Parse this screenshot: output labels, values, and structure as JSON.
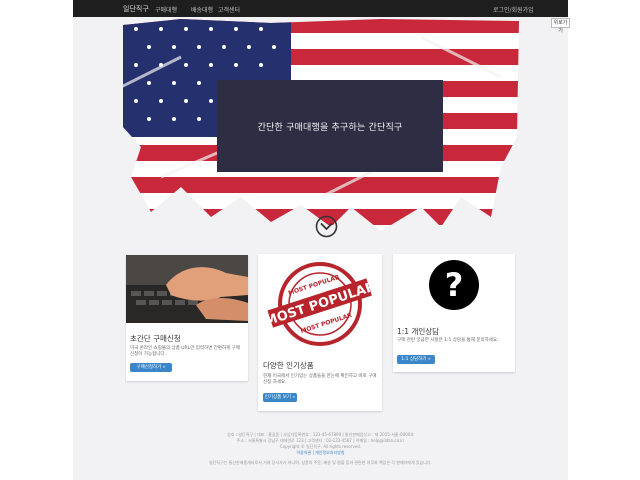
{
  "topbar": {
    "logo": "일단직구",
    "nav": [
      "구매대행",
      "배송대행",
      "고객센터"
    ],
    "right": "로그인/회원가입"
  },
  "side_tag": "위로가기",
  "hero": {
    "headline": "간단한 구매대행을 추구하는 간단직구"
  },
  "cards": [
    {
      "title": "초간단 구매신청",
      "desc": "미국 온라인 쇼핑몰의 상품 URL만 입력하면 간편하게 구매신청이 가능합니다.",
      "button": "구매신청하기 »"
    },
    {
      "title": "다양한 인기상품",
      "desc": "현재 미국에서 인기있는 상품들을 한눈에 확인하고 바로 구매신청 하세요.",
      "button": "인기상품 보기 »"
    },
    {
      "title": "1:1 개인상담",
      "desc": "구매 관련 궁금한 사항은 1:1 상담을 통해 문의하세요.",
      "button": "1:1 상담하기 »"
    }
  ],
  "footer": {
    "line1": "상호 : 일단직구 | 대표 : 홍길동 | 사업자등록번호 : 123-45-67890 | 통신판매업신고 : 제 2015-서울-0000호",
    "line2": "주소 : 서울특별시 강남구 테헤란로 123 | 고객센터 : 02-123-4567 | 이메일 : help@ildan.co.kr",
    "line3": "Copyright © 일단직구. All rights reserved.",
    "line4": "이용약관 | 개인정보처리방침",
    "line5": "일단직구는 통신판매중개자로서 거래 당사자가 아니며, 상품의 주문, 배송 및 환불 등과 관련한 의무와 책임은 각 판매자에게 있습니다."
  },
  "colors": {
    "topbar": "#1e1e1e",
    "hero_box": "#2e2d44",
    "button": "#3a86c8",
    "flag_red": "#c8283a",
    "flag_blue": "#25306e"
  },
  "icons": [
    "chevron-down-circle-icon",
    "question-mark-icon",
    "most-popular-stamp"
  ]
}
